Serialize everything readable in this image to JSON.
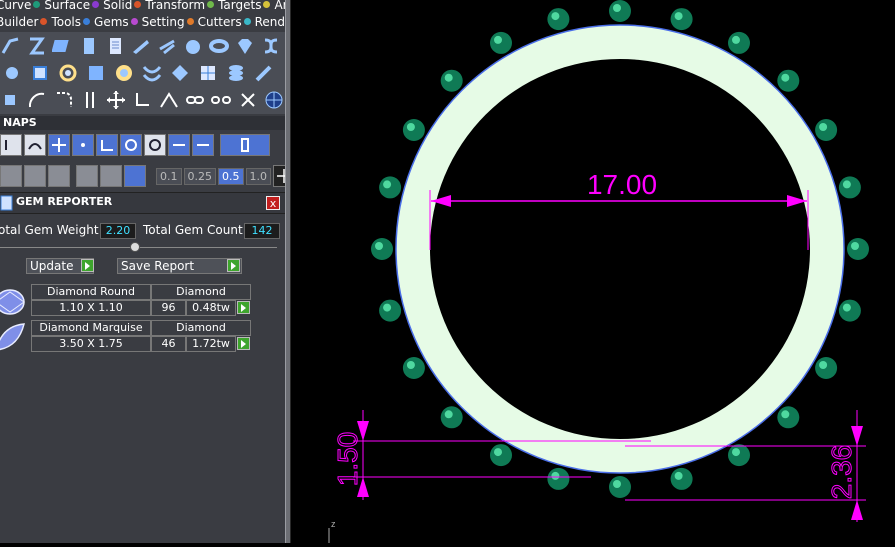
{
  "menu": {
    "row1": [
      {
        "label": "Curve",
        "color": "#1e9a7a"
      },
      {
        "label": "Surface",
        "color": "#8a3ad0"
      },
      {
        "label": "Solid",
        "color": "#d9542a"
      },
      {
        "label": "Transform",
        "color": "#6fb84a"
      },
      {
        "label": "Targets",
        "color": "#d6c23a"
      },
      {
        "label": "Art",
        "color": ""
      }
    ],
    "row1_first": "Curve",
    "row2": [
      {
        "label": "Builder",
        "color": "#d9542a"
      },
      {
        "label": "Tools",
        "color": "#3a7fd9"
      },
      {
        "label": "Gems",
        "color": "#b84ad0"
      },
      {
        "label": "Setting",
        "color": "#e07a2a"
      },
      {
        "label": "Cutters",
        "color": "#3ab8c8"
      },
      {
        "label": "Render",
        "color": ""
      }
    ]
  },
  "snaps_header": "NAPS",
  "grid_values": [
    "0.1",
    "0.25",
    "0.5",
    "1.0"
  ],
  "gem_reporter": {
    "title": "GEM REPORTER",
    "close": "x",
    "total_weight_label": "otal Gem Weight",
    "total_weight_value": "2.20",
    "total_count_label": "Total Gem Count",
    "total_count_value": "142",
    "update_label": "Update",
    "save_label": "Save Report",
    "rows": [
      {
        "name": "Diamond Round",
        "material": "Diamond",
        "size": "1.10 X 1.10",
        "count": "96",
        "weight": "0.48tw"
      },
      {
        "name": "Diamond Marquise",
        "material": "Diamond",
        "size": "3.50 X 1.75",
        "count": "46",
        "weight": "1.72tw"
      }
    ]
  },
  "viewport": {
    "dim_diameter": "17.00",
    "dim_height": "1.50",
    "dim_offset": "2.36",
    "axis_label": "z",
    "ring_color": "#e6fbe6",
    "dim_color": "#ff00ff",
    "gem_color": "#0f7a55"
  }
}
